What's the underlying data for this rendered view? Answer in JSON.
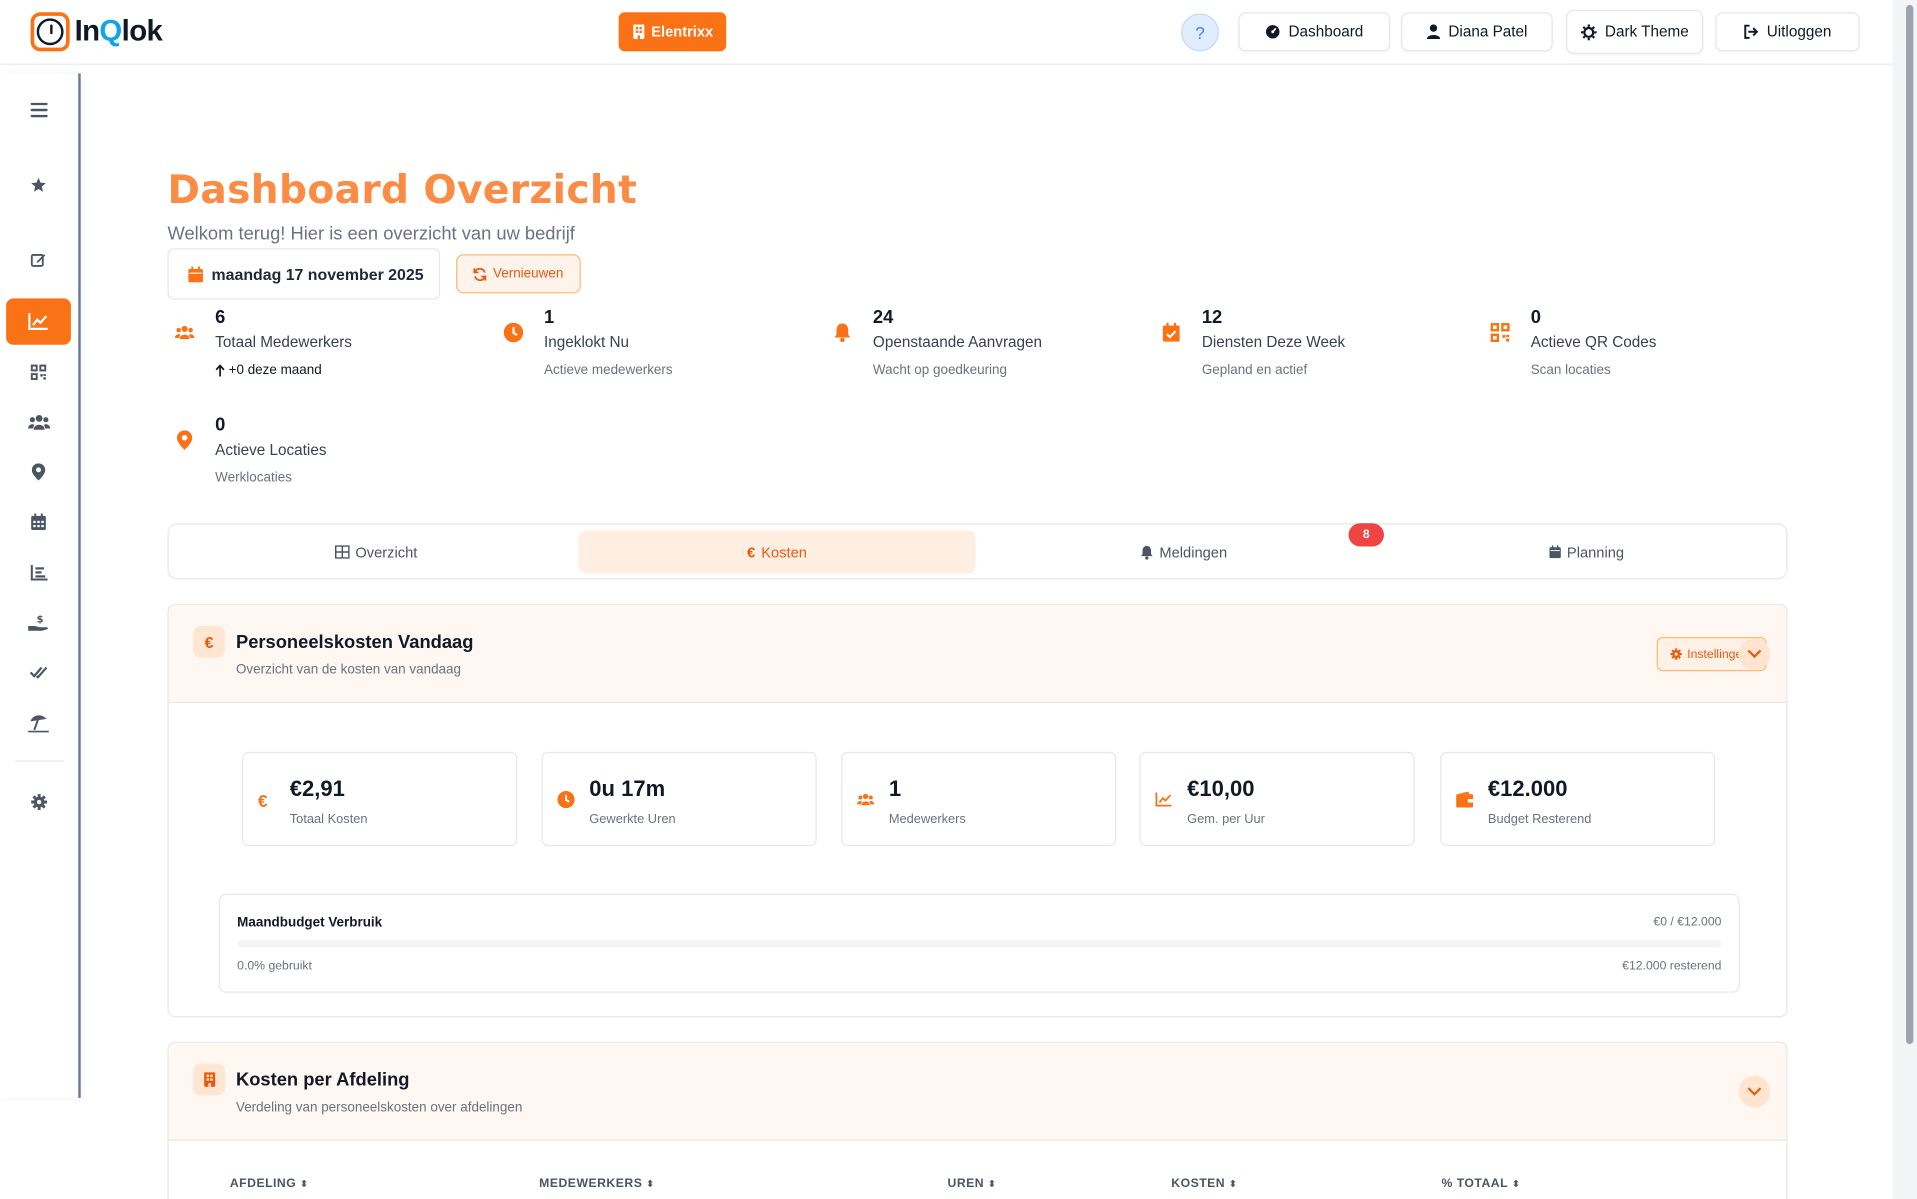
{
  "app": {
    "name_prefix": "In",
    "name_q": "Q",
    "name_suffix": "lok",
    "accent": "#f97316",
    "title_color": "#fb8c45"
  },
  "header": {
    "company": "Elentrixx",
    "help_label": "?",
    "buttons": {
      "dashboard": "Dashboard",
      "user": "Diana Patel",
      "theme": "Dark Theme",
      "logout": "Uitloggen"
    }
  },
  "sidebar": {
    "items": [
      {
        "icon": "menu-icon",
        "active": false
      },
      {
        "icon": "star-icon",
        "active": false
      },
      {
        "icon": "edit-icon",
        "active": false
      },
      {
        "icon": "chart-line-icon",
        "active": true
      },
      {
        "icon": "qr-code-icon",
        "active": false
      },
      {
        "icon": "users-icon",
        "active": false
      },
      {
        "icon": "location-pin-icon",
        "active": false
      },
      {
        "icon": "calendar-icon",
        "active": false
      },
      {
        "icon": "bar-chart-icon",
        "active": false
      },
      {
        "icon": "hand-money-icon",
        "active": false
      },
      {
        "icon": "double-check-icon",
        "active": false
      },
      {
        "icon": "beach-umbrella-icon",
        "active": false
      },
      {
        "icon": "gear-icon",
        "active": false
      }
    ]
  },
  "page": {
    "title": "Dashboard Overzicht",
    "subtitle": "Welkom terug! Hier is een overzicht van uw bedrijf",
    "date": "maandag 17 november 2025",
    "refresh": "Vernieuwen"
  },
  "stats": [
    {
      "value": "6",
      "label": "Totaal Medewerkers",
      "sub": "+0 deze maand",
      "icon": "users-icon"
    },
    {
      "value": "1",
      "label": "Ingeklokt Nu",
      "sub": "Actieve medewerkers",
      "icon": "clock-icon"
    },
    {
      "value": "24",
      "label": "Openstaande Aanvragen",
      "sub": "Wacht op goedkeuring",
      "icon": "bell-icon"
    },
    {
      "value": "12",
      "label": "Diensten Deze Week",
      "sub": "Gepland en actief",
      "icon": "calendar-check-icon"
    },
    {
      "value": "0",
      "label": "Actieve QR Codes",
      "sub": "Scan locaties",
      "icon": "qr-code-icon"
    },
    {
      "value": "0",
      "label": "Actieve Locaties",
      "sub": "Werklocaties",
      "icon": "location-pin-icon"
    }
  ],
  "tabs": [
    {
      "label": "Overzicht",
      "icon": "table-icon"
    },
    {
      "label": "Kosten",
      "icon": "euro-icon"
    },
    {
      "label": "Meldingen",
      "icon": "bell-icon"
    },
    {
      "label": "Planning",
      "icon": "calendar-icon"
    }
  ],
  "notifications_badge": "8",
  "costs_today": {
    "title": "Personeelskosten Vandaag",
    "subtitle": "Overzicht van de kosten van vandaag",
    "icon_glyph": "€",
    "settings": "Instellingen",
    "metrics": [
      {
        "value": "€2,91",
        "label": "Totaal Kosten",
        "icon": "euro-icon"
      },
      {
        "value": "0u 17m",
        "label": "Gewerkte Uren",
        "icon": "clock-icon"
      },
      {
        "value": "1",
        "label": "Medewerkers",
        "icon": "users-icon"
      },
      {
        "value": "€10,00",
        "label": "Gem. per Uur",
        "icon": "chart-line-icon"
      },
      {
        "value": "€12.000",
        "label": "Budget Resterend",
        "icon": "wallet-icon"
      }
    ],
    "budget": {
      "title": "Maandbudget Verbruik",
      "amount": "€0 / €12.000",
      "used": "0.0% gebruikt",
      "remaining": "€12.000 resterend",
      "used_fraction": 0.0
    }
  },
  "dept_costs": {
    "title": "Kosten per Afdeling",
    "subtitle": "Verdeling van personeelskosten over afdelingen",
    "columns": [
      "AFDELING",
      "MEDEWERKERS",
      "UREN",
      "KOSTEN",
      "% TOTAAL"
    ]
  }
}
